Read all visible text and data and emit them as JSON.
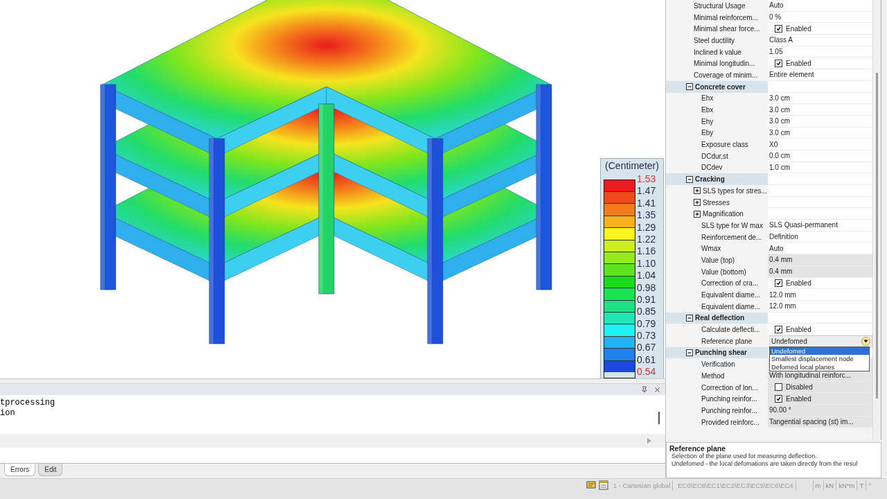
{
  "viewport": {
    "legend": {
      "title": "(Centimeter)",
      "bands": [
        {
          "color": "#e81c1c"
        },
        {
          "color": "#f0481a"
        },
        {
          "color": "#f27c1c"
        },
        {
          "color": "#f6b21c"
        },
        {
          "color": "#fbf61e"
        },
        {
          "color": "#c9f01e"
        },
        {
          "color": "#96ea1e"
        },
        {
          "color": "#5ee41e"
        },
        {
          "color": "#18dc18"
        },
        {
          "color": "#18e450"
        },
        {
          "color": "#1ae282"
        },
        {
          "color": "#20e6b6"
        },
        {
          "color": "#1ef2f2"
        },
        {
          "color": "#22b2f0"
        },
        {
          "color": "#1e80ec"
        },
        {
          "color": "#1e46e0"
        }
      ],
      "labels": [
        {
          "text": "1.53",
          "extreme": true
        },
        {
          "text": "1.47",
          "extreme": false
        },
        {
          "text": "1.41",
          "extreme": false
        },
        {
          "text": "1.35",
          "extreme": false
        },
        {
          "text": "1.29",
          "extreme": false
        },
        {
          "text": "1.22",
          "extreme": false
        },
        {
          "text": "1.16",
          "extreme": false
        },
        {
          "text": "1.10",
          "extreme": false
        },
        {
          "text": "1.04",
          "extreme": false
        },
        {
          "text": "0.98",
          "extreme": false
        },
        {
          "text": "0.91",
          "extreme": false
        },
        {
          "text": "0.85",
          "extreme": false
        },
        {
          "text": "0.79",
          "extreme": false
        },
        {
          "text": "0.73",
          "extreme": false
        },
        {
          "text": "0.67",
          "extreme": false
        },
        {
          "text": "0.61",
          "extreme": false
        },
        {
          "text": "0.54",
          "extreme": true
        }
      ]
    }
  },
  "property_tree": [
    {
      "kind": "text",
      "label": "Structural Usage",
      "value": "Auto",
      "readonly": false
    },
    {
      "kind": "text",
      "label": "Minimal reinforcem...",
      "value": "0 %",
      "readonly": false
    },
    {
      "kind": "check",
      "label": "Minimal shear force...",
      "value": "Enabled",
      "checked": true,
      "readonly": false
    },
    {
      "kind": "text",
      "label": "Steel ductility",
      "value": "Class A",
      "readonly": false
    },
    {
      "kind": "text",
      "label": "Inclined k value",
      "value": "1.05",
      "readonly": false
    },
    {
      "kind": "check",
      "label": "Minimal longitudin...",
      "value": "Enabled",
      "checked": true,
      "readonly": false
    },
    {
      "kind": "text",
      "label": "Coverage of minim...",
      "value": "Entire element",
      "readonly": false
    },
    {
      "kind": "group",
      "label": "Concrete cover",
      "expanded": true,
      "children": [
        {
          "kind": "text",
          "label": "Ehx",
          "value": "3.0 cm",
          "readonly": false
        },
        {
          "kind": "text",
          "label": "Ebx",
          "value": "3.0 cm",
          "readonly": false
        },
        {
          "kind": "text",
          "label": "Ehy",
          "value": "3.0 cm",
          "readonly": false
        },
        {
          "kind": "text",
          "label": "Eby",
          "value": "3.0 cm",
          "readonly": false
        },
        {
          "kind": "text",
          "label": "Exposure class",
          "value": "X0",
          "readonly": false
        },
        {
          "kind": "text",
          "label": "DCdur,st",
          "value": "0.0 cm",
          "readonly": false
        },
        {
          "kind": "text",
          "label": "DCdev",
          "value": "1.0 cm",
          "readonly": false
        }
      ]
    },
    {
      "kind": "group",
      "label": "Cracking",
      "expanded": true,
      "children": [
        {
          "kind": "group",
          "label": "SLS types for stres...",
          "expanded": false
        },
        {
          "kind": "group",
          "label": "Stresses",
          "expanded": false
        },
        {
          "kind": "group",
          "label": "Magnification",
          "expanded": false
        },
        {
          "kind": "text",
          "label": "SLS type for W max",
          "value": "SLS Quasi-permanent",
          "readonly": false
        },
        {
          "kind": "text",
          "label": "Reinforcement de...",
          "value": "Definition",
          "readonly": false
        },
        {
          "kind": "text",
          "label": "Wmax",
          "value": "Auto",
          "readonly": false
        },
        {
          "kind": "text",
          "label": "Value (top)",
          "value": "0.4 mm",
          "readonly": true
        },
        {
          "kind": "text",
          "label": "Value (bottom)",
          "value": "0.4 mm",
          "readonly": true
        },
        {
          "kind": "check",
          "label": "Correction of cra...",
          "value": "Enabled",
          "checked": true,
          "readonly": false
        },
        {
          "kind": "text",
          "label": "Equivalent diame...",
          "value": "12.0 mm",
          "readonly": false
        },
        {
          "kind": "text",
          "label": "Equivalent diame...",
          "value": "12.0 mm",
          "readonly": false
        }
      ]
    },
    {
      "kind": "group",
      "label": "Real deflection",
      "expanded": true,
      "children": [
        {
          "kind": "check",
          "label": "Calculate deflecti...",
          "value": "Enabled",
          "checked": true,
          "readonly": false
        },
        {
          "kind": "dropdown",
          "label": "Reference plane",
          "value": "Undefomed",
          "open": true,
          "options": [
            {
              "label": "Undefomed",
              "selected": true
            },
            {
              "label": "Smallest displacement node",
              "selected": false
            },
            {
              "label": "Defomed local planes",
              "selected": false
            }
          ]
        }
      ]
    },
    {
      "kind": "group",
      "label": "Punching shear",
      "expanded": true,
      "children": [
        {
          "kind": "text",
          "label": "Verification",
          "readonly": true
        },
        {
          "kind": "text",
          "label": "Method",
          "value": "With longitudinal reinforc...",
          "readonly": true
        },
        {
          "kind": "check",
          "label": "Correction of lon...",
          "value": "Disabled",
          "checked": false,
          "readonly": true
        },
        {
          "kind": "check",
          "label": "Punching reinfor...",
          "value": "Enabled",
          "checked": true,
          "readonly": true
        },
        {
          "kind": "text",
          "label": "Punching reinfor...",
          "value": "90.00 °",
          "readonly": true
        },
        {
          "kind": "text",
          "label": "Provided reinforc...",
          "value": "Tangential spacing (st) im...",
          "readonly": true
        }
      ]
    }
  ],
  "description": {
    "title": "Reference plane",
    "lines": [
      "Selection of the plane used for measuring deflection.",
      "Undefomed - the local defomations are taken directly from the resul"
    ]
  },
  "output_panel": {
    "lines": [
      "tprocessing",
      "ion"
    ]
  },
  "bottom_tabs": [
    {
      "label": "Errors",
      "selected": true
    },
    {
      "label": "Edit",
      "selected": false
    }
  ],
  "status_bar": {
    "coordinate_system": "1 - Cartesian global",
    "codes": "EC0\\EC8\\EC1\\EC2\\EC3\\EC5\\EC6\\EC4",
    "units": [
      "m",
      "kN",
      "kN*m",
      "T",
      "°"
    ]
  }
}
